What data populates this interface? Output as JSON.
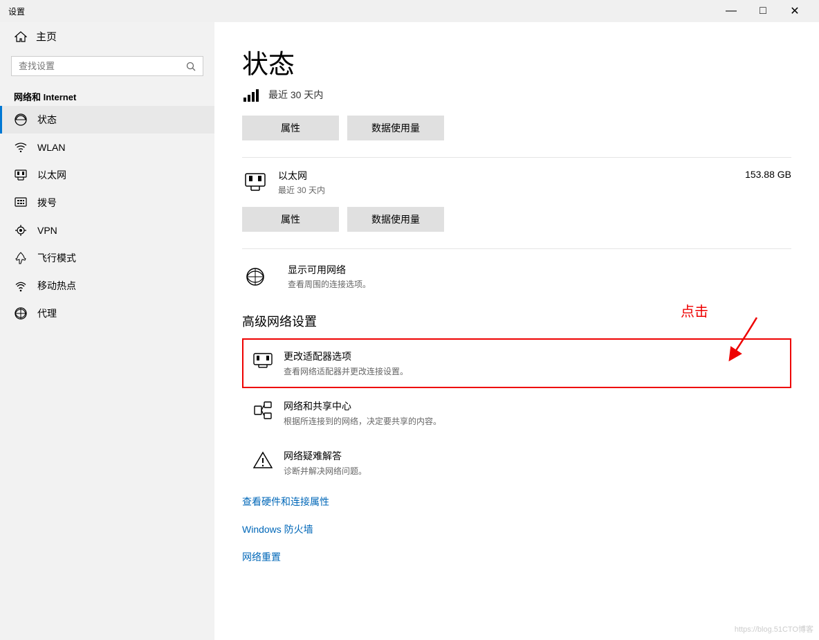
{
  "window": {
    "title": "设置"
  },
  "titlebar": {
    "minimize": "—",
    "maximize": "□",
    "close": "✕"
  },
  "sidebar": {
    "home_label": "主页",
    "search_placeholder": "查找设置",
    "section_title": "网络和 Internet",
    "items": [
      {
        "id": "status",
        "label": "状态",
        "active": true
      },
      {
        "id": "wlan",
        "label": "WLAN",
        "active": false
      },
      {
        "id": "ethernet",
        "label": "以太网",
        "active": false
      },
      {
        "id": "dialup",
        "label": "拨号",
        "active": false
      },
      {
        "id": "vpn",
        "label": "VPN",
        "active": false
      },
      {
        "id": "airplane",
        "label": "飞行模式",
        "active": false
      },
      {
        "id": "hotspot",
        "label": "移动热点",
        "active": false
      },
      {
        "id": "proxy",
        "label": "代理",
        "active": false
      }
    ]
  },
  "content": {
    "page_title": "状态",
    "connection_label": "最近 30 天内",
    "wifi_section": {
      "btn_properties": "属性",
      "btn_data_usage": "数据使用量"
    },
    "ethernet_section": {
      "name": "以太网",
      "sub": "最近 30 天内",
      "data": "153.88 GB",
      "btn_properties": "属性",
      "btn_data_usage": "数据使用量"
    },
    "show_networks": {
      "title": "显示可用网络",
      "desc": "查看周围的连接选项。"
    },
    "advanced_title": "高级网络设置",
    "advanced_items": [
      {
        "id": "adapter",
        "title": "更改适配器选项",
        "desc": "查看网络适配器并更改连接设置。",
        "highlighted": true
      },
      {
        "id": "sharing",
        "title": "网络和共享中心",
        "desc": "根据所连接到的网络，决定要共享的内容。"
      },
      {
        "id": "troubleshoot",
        "title": "网络疑难解答",
        "desc": "诊断并解决网络问题。"
      }
    ],
    "links": [
      "查看硬件和连接属性",
      "Windows 防火墙",
      "网络重置"
    ],
    "annotation": {
      "label": "点击",
      "arrow_hint": "red arrow pointing to 更改适配器选项"
    }
  },
  "watermark": "https://blog.51CTO博客"
}
